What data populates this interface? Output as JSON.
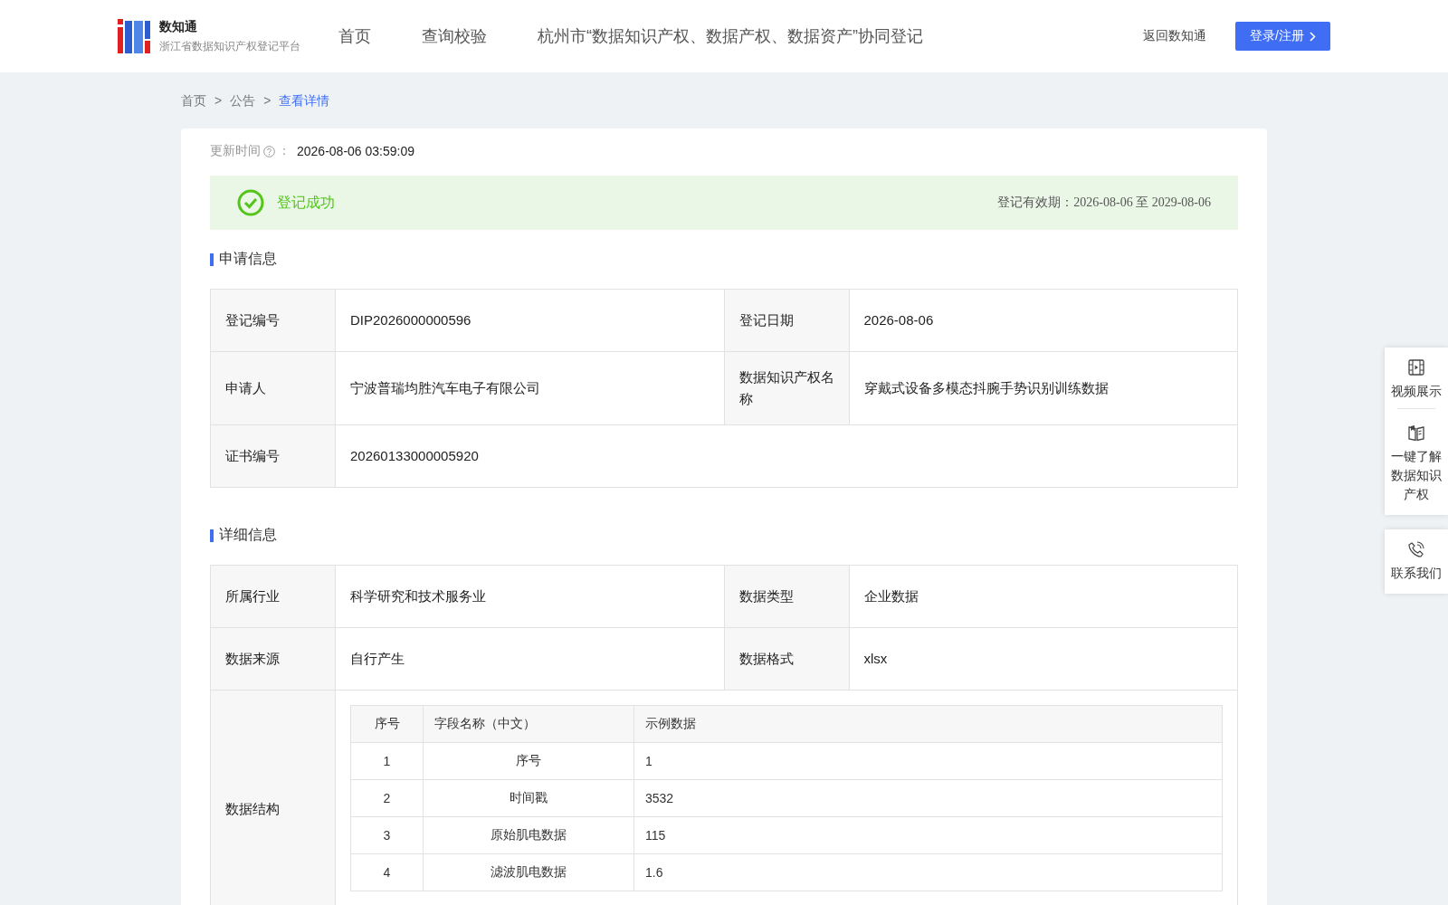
{
  "header": {
    "logo_title": "数知通",
    "logo_subtitle": "浙江省数据知识产权登记平台",
    "nav": [
      {
        "label": "首页"
      },
      {
        "label": "查询校验"
      },
      {
        "label": "杭州市“数据知识产权、数据产权、数据资产”协同登记"
      }
    ],
    "back_link": "返回数知通",
    "login_button": "登录/注册"
  },
  "breadcrumb": {
    "separator": ">",
    "items": [
      {
        "label": "首页",
        "selected": false
      },
      {
        "label": "公告",
        "selected": false
      },
      {
        "label": "查看详情",
        "selected": true
      }
    ]
  },
  "update": {
    "label": "更新时间",
    "separator": "：",
    "value": "2026-08-06 03:59:09"
  },
  "status": {
    "kind": "success",
    "text": "登记成功",
    "validity": "登记有效期：2026-08-06 至 2029-08-06"
  },
  "sections": [
    {
      "title": "申请信息",
      "rows": [
        {
          "fields": [
            {
              "label": "登记编号",
              "value": "DIP2026000000596"
            },
            {
              "label": "登记日期",
              "value": "2026-08-06"
            }
          ]
        },
        {
          "fields": [
            {
              "label": "申请人",
              "value": "宁波普瑞均胜汽车电子有限公司"
            },
            {
              "label": "数据知识产权名称",
              "value": "穿戴式设备多模态抖腕手势识别训练数据"
            }
          ]
        },
        {
          "fields": [
            {
              "label": "证书编号",
              "value": "20260133000005920"
            }
          ]
        }
      ]
    },
    {
      "title": "详细信息",
      "rows": [
        {
          "fields": [
            {
              "label": "所属行业",
              "value": "科学研究和技术服务业"
            },
            {
              "label": "数据类型",
              "value": "企业数据"
            }
          ]
        },
        {
          "fields": [
            {
              "label": "数据来源",
              "value": "自行产生"
            },
            {
              "label": "数据格式",
              "value": "xlsx"
            }
          ]
        },
        {
          "label": "数据结构",
          "structure": {
            "columns": [
              "序号",
              "字段名称（中文）",
              "示例数据"
            ],
            "rows": [
              [
                "1",
                "序号",
                "1"
              ],
              [
                "2",
                "时间戳",
                "3532"
              ],
              [
                "3",
                "原始肌电数据",
                "115"
              ],
              [
                "4",
                "滤波肌电数据",
                "1.6"
              ]
            ]
          }
        }
      ]
    }
  ],
  "side_panels": [
    {
      "items": [
        {
          "kind": "video",
          "label": "视频展示"
        },
        {
          "kind": "book",
          "label": "一键了解数据知识产权"
        }
      ]
    },
    {
      "items": [
        {
          "kind": "phone",
          "label": "联系我们"
        }
      ]
    }
  ]
}
